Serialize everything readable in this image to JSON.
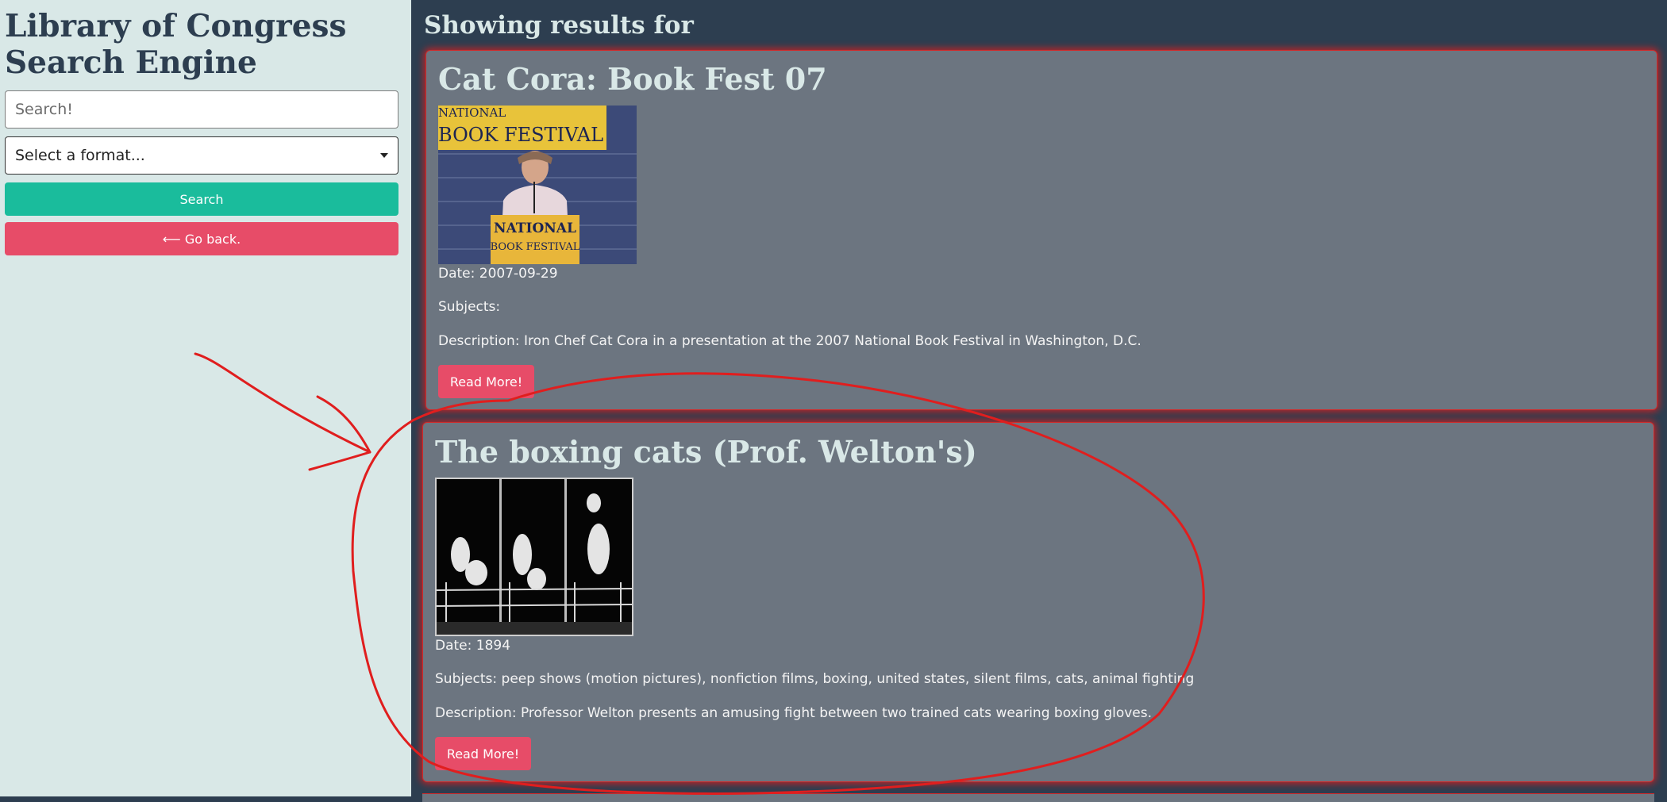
{
  "sidebar": {
    "title": "Library of Congress Search Engine",
    "search_placeholder": "Search!",
    "format_select": "Select a format...",
    "search_button": "Search",
    "back_button": "⟵ Go back."
  },
  "main": {
    "heading": "Showing results for",
    "results": [
      {
        "title": "Cat Cora: Book Fest 07",
        "thumbnail": "National Book Festival podium photo",
        "thumbnail_texts": [
          "NATIONAL",
          "BOOK FESTIVAL",
          "NATIONAL",
          "BOOK FESTIVAL"
        ],
        "date": "Date: 2007-09-29",
        "subjects": "Subjects:",
        "description": "Description: Iron Chef Cat Cora in a presentation at the 2007 National Book Festival in Washington, D.C.",
        "read_more": "Read More!"
      },
      {
        "title": "The boxing cats (Prof. Welton's)",
        "thumbnail": "black and white film strip of boxing cats",
        "date": "Date: 1894",
        "subjects": "Subjects: peep shows (motion pictures), nonfiction films, boxing, united states, silent films, cats, animal fighting",
        "description": "Description: Professor Welton presents an amusing fight between two trained cats wearing boxing gloves.",
        "read_more": "Read More!"
      }
    ]
  },
  "colors": {
    "sidebar_bg": "#d9e8e7",
    "main_bg": "#2d3e50",
    "card_bg": "#6c7580",
    "accent_green": "#1abc9c",
    "accent_red": "#e74c68",
    "annotation_red": "#e01e1e"
  }
}
